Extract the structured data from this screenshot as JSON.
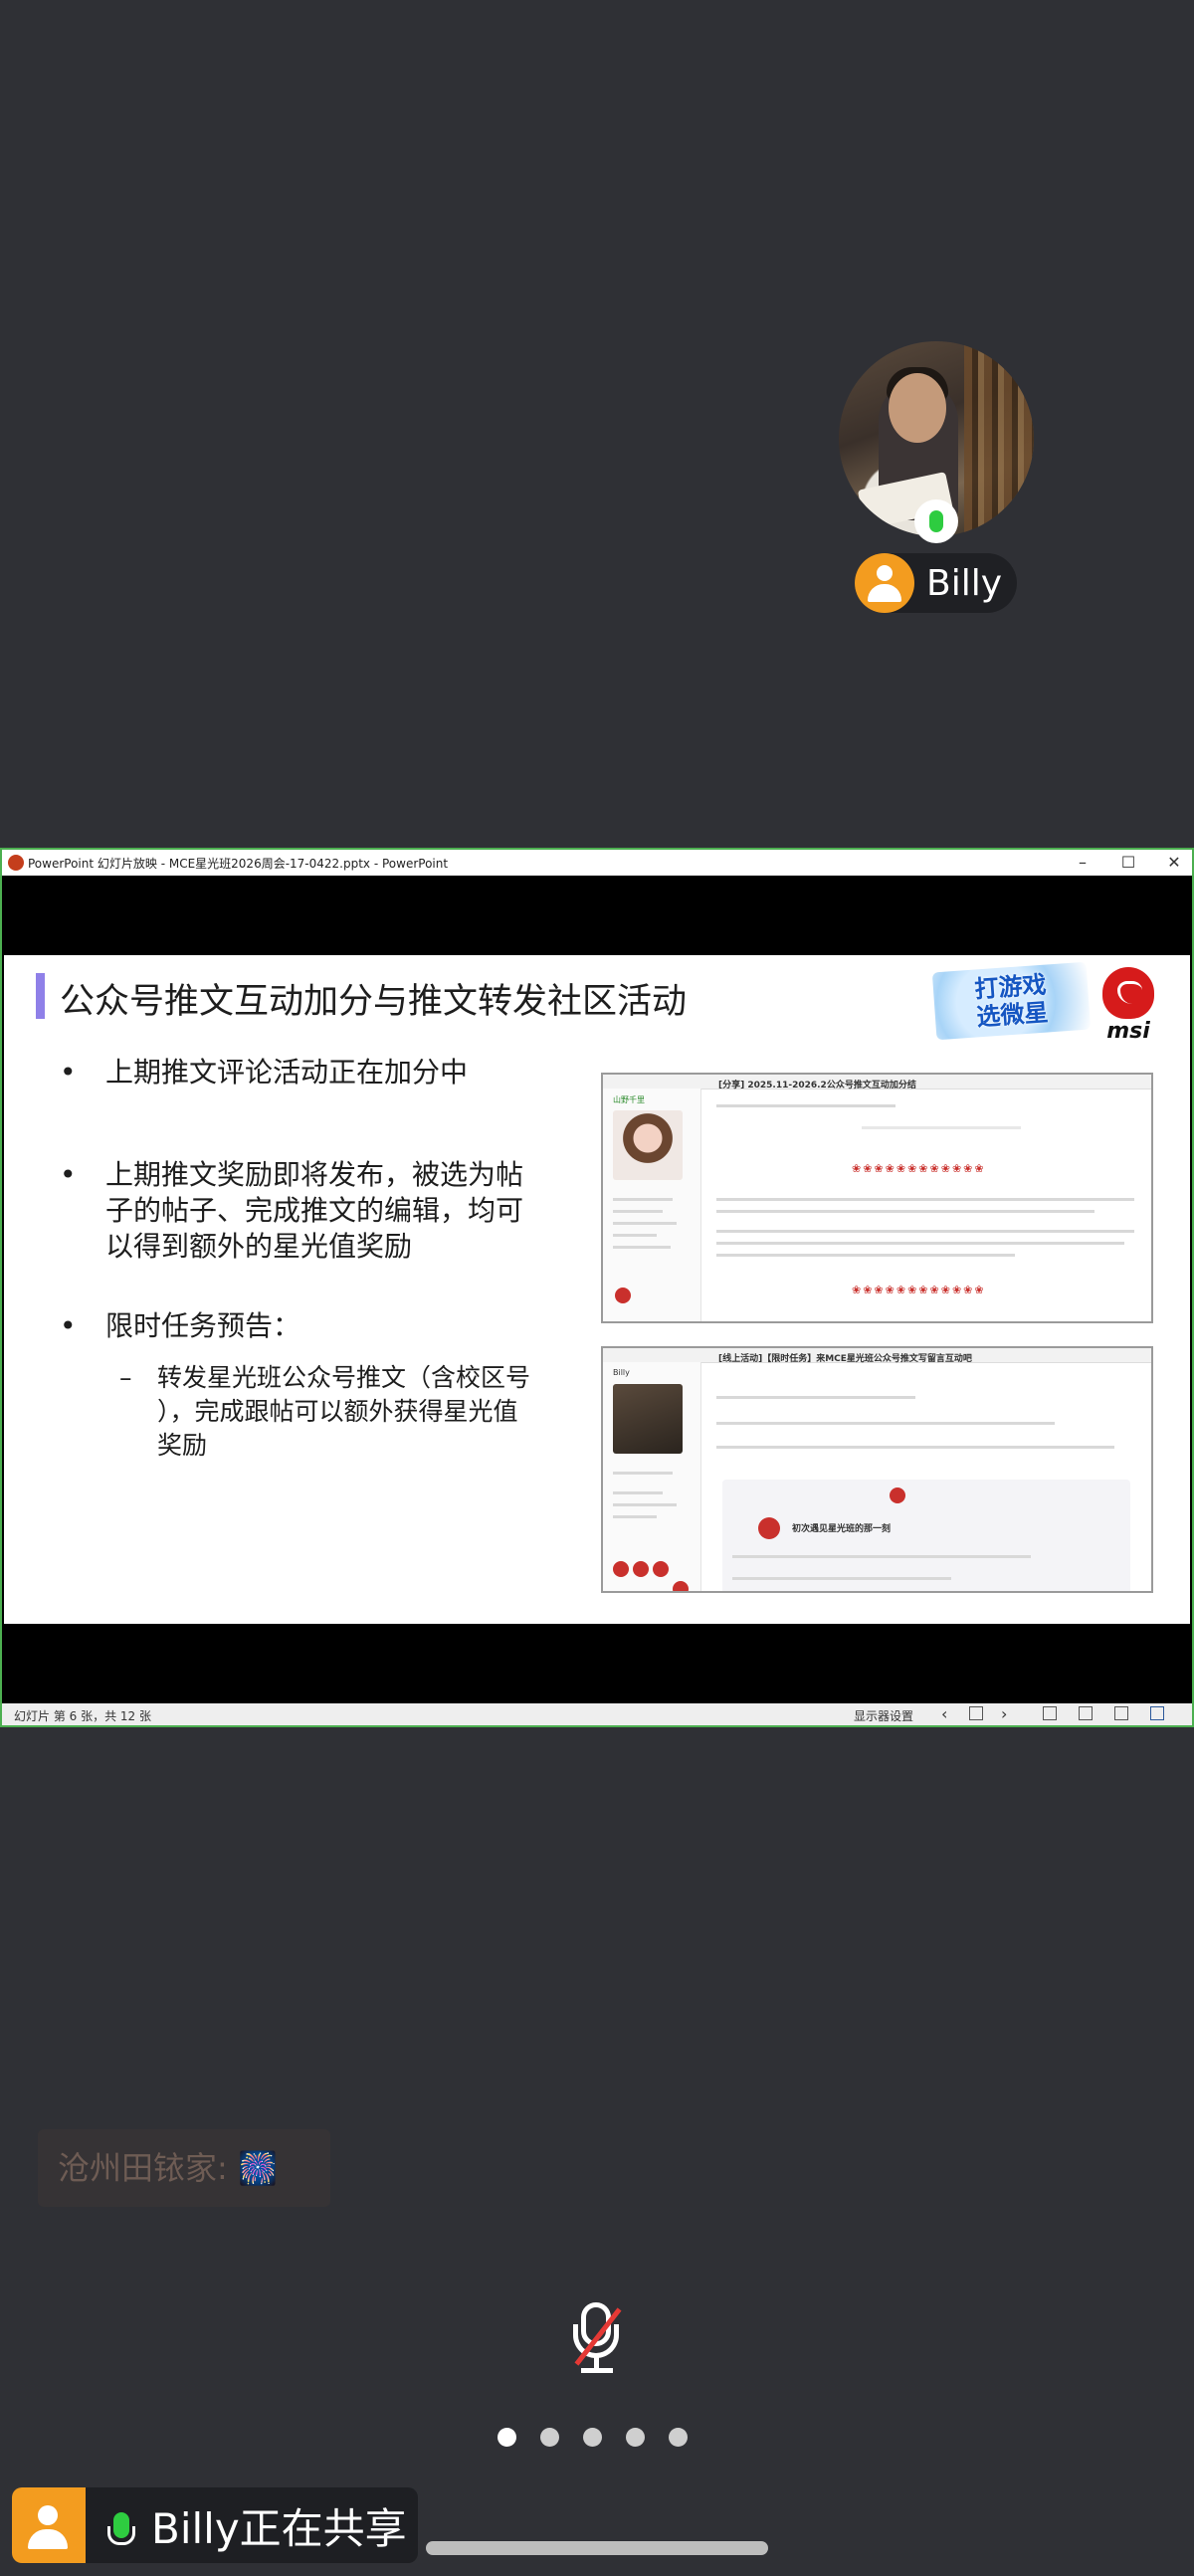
{
  "participant": {
    "name": "Billy"
  },
  "window": {
    "title": "PowerPoint 幻灯片放映 - MCE星光班2026周会-17-0422.pptx - PowerPoint",
    "controls": {
      "minimize": "–",
      "maximize": "☐",
      "close": "✕"
    }
  },
  "slide": {
    "title": "公众号推文互动加分与推文转发社区活动",
    "logo_text_line1": "打游戏",
    "logo_text_line2": "选微星",
    "brand": "msi",
    "bullets": [
      "上期推文评论活动正在加分中",
      "上期推文奖励即将发布，被选为帖子的帖子、完成推文的编辑，均可以得到额外的星光值奖励",
      "限时任务预告："
    ],
    "bullet2_lines": [
      "上期推文奖励即将发布，被选为帖",
      "子的帖子、完成推文的编辑，均可",
      "以得到额外的星光值奖励"
    ],
    "sub_lines": [
      "转发星光班公众号推文（含校区号",
      "），完成跟帖可以额外获得星光值",
      "奖励"
    ],
    "screenshot1_title": "[分享] 2025.11-2026.2公众号推文互动加分结",
    "screenshot1_user": "山野千里",
    "screenshot2_title": "[线上活动]【限时任务】来MCE星光班公众号推文写留言互动吧",
    "screenshot2_user": "Billy",
    "screenshot2_quote": "初次遇见星光班的那一刻"
  },
  "statusbar": {
    "slide_info": "幻灯片 第 6 张，共 12 张",
    "display_settings": "显示器设置"
  },
  "chat": {
    "message": "沧州田铱家: 🎆"
  },
  "pager": {
    "count": 5,
    "active": 0
  },
  "share_banner": {
    "text": "Billy正在共享"
  },
  "colors": {
    "accent": "#f39c1f",
    "mic_on": "#2ecc40",
    "border_share": "#4caf50"
  }
}
